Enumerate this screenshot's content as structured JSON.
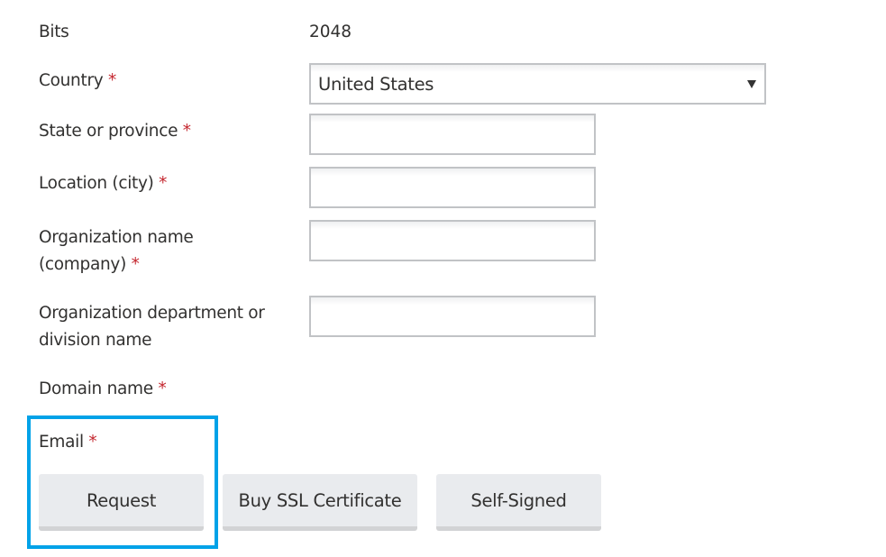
{
  "form": {
    "bits": {
      "label": "Bits",
      "value": "2048"
    },
    "country": {
      "label": "Country",
      "required_mark": "*",
      "value": "United States"
    },
    "state": {
      "label": "State or province",
      "required_mark": "*",
      "value": ""
    },
    "city": {
      "label": "Location (city)",
      "required_mark": "*",
      "value": ""
    },
    "organization": {
      "label_line1": "Organization name",
      "label_line2": "(company)",
      "required_mark": "*",
      "value": ""
    },
    "department": {
      "label_line1": "Organization department or",
      "label_line2": "division name",
      "value": ""
    },
    "domain": {
      "label": "Domain name",
      "required_mark": "*"
    },
    "email": {
      "label": "Email",
      "required_mark": "*"
    }
  },
  "buttons": {
    "request": "Request",
    "buy_ssl": "Buy SSL Certificate",
    "self_signed": "Self-Signed"
  },
  "colors": {
    "required": "#c4262e",
    "highlight": "#00a2e8",
    "button_bg": "#e9ebee"
  }
}
